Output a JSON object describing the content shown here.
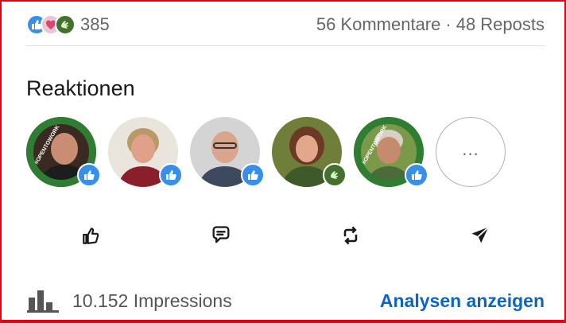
{
  "social": {
    "reactions": {
      "icons": [
        "like-icon",
        "love-icon",
        "support-icon"
      ],
      "count": "385"
    },
    "comments_label": "56 Kommentare",
    "separator": "·",
    "reposts_label": "48 Reposts"
  },
  "reactions_section": {
    "title": "Reaktionen",
    "people": [
      {
        "reaction": "like-icon",
        "frame": "#OPENTOWORK"
      },
      {
        "reaction": "like-icon",
        "frame": ""
      },
      {
        "reaction": "like-icon",
        "frame": ""
      },
      {
        "reaction": "support-icon",
        "frame": ""
      },
      {
        "reaction": "like-icon",
        "frame": "#OPENTOWORK"
      }
    ],
    "more_label": "..."
  },
  "actions": {
    "items": [
      "like-icon",
      "comment-icon",
      "repost-icon",
      "send-icon"
    ]
  },
  "footer": {
    "impressions_label": "10.152 Impressions",
    "analytics_link": "Analysen anzeigen"
  },
  "colors": {
    "accent": "#0a66c2",
    "like": "#378fe9",
    "support": "#44712e",
    "opentowork": "#2e7d32",
    "frame_border": "#e4000f"
  }
}
